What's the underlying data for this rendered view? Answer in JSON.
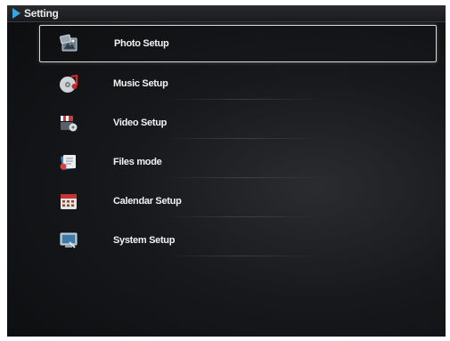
{
  "header": {
    "title": "Setting"
  },
  "menu": {
    "items": [
      {
        "label": "Photo Setup",
        "icon": "photo-icon",
        "selected": true
      },
      {
        "label": "Music Setup",
        "icon": "music-icon",
        "selected": false
      },
      {
        "label": "Video Setup",
        "icon": "video-icon",
        "selected": false
      },
      {
        "label": "Files mode",
        "icon": "files-icon",
        "selected": false
      },
      {
        "label": "Calendar Setup",
        "icon": "calendar-icon",
        "selected": false
      },
      {
        "label": "System Setup",
        "icon": "system-icon",
        "selected": false
      }
    ]
  },
  "colors": {
    "accent": "#3aa6e0",
    "background": "#141518",
    "text": "#f2f2f2",
    "selection_border": "#d8d8d8"
  }
}
